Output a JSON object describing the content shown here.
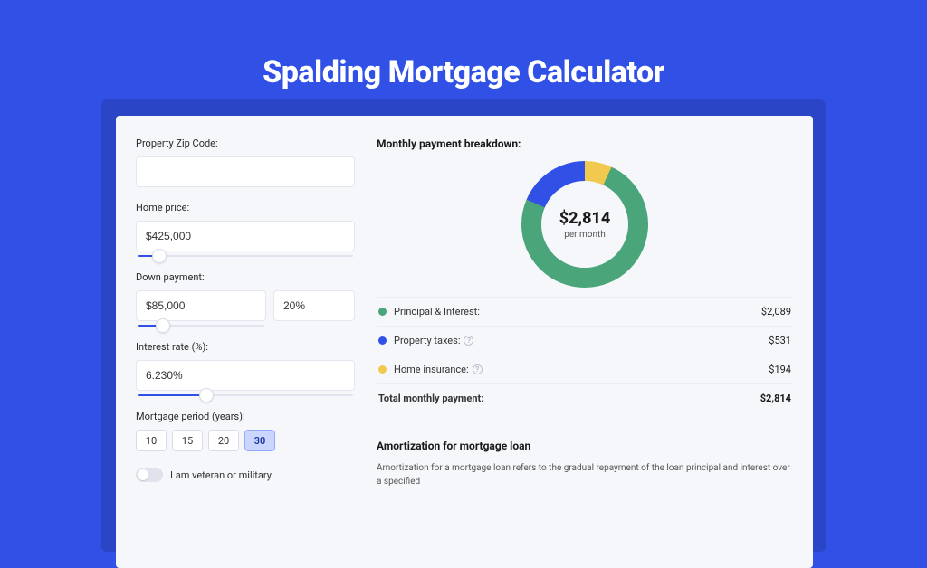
{
  "page": {
    "title": "Spalding Mortgage Calculator"
  },
  "form": {
    "zip": {
      "label": "Property Zip Code:",
      "value": ""
    },
    "home_price": {
      "label": "Home price:",
      "value": "$425,000",
      "slider_pct": 10
    },
    "down_payment": {
      "label": "Down payment:",
      "amount": "$85,000",
      "pct": "20%",
      "slider_pct": 20
    },
    "interest_rate": {
      "label": "Interest rate (%):",
      "value": "6.230%",
      "slider_pct": 32
    },
    "period": {
      "label": "Mortgage period (years):",
      "options": [
        "10",
        "15",
        "20",
        "30"
      ],
      "selected": "30"
    },
    "veteran": {
      "label": "I am veteran or military",
      "value": false
    }
  },
  "breakdown": {
    "title": "Monthly payment breakdown:",
    "amount": "$2,814",
    "sub": "per month",
    "items": [
      {
        "label": "Principal & Interest:",
        "value": "$2,089",
        "color": "#4aa57a",
        "help": false
      },
      {
        "label": "Property taxes:",
        "value": "$531",
        "color": "#3151e6",
        "help": true
      },
      {
        "label": "Home insurance:",
        "value": "$194",
        "color": "#f1c94f",
        "help": true
      }
    ],
    "total_label": "Total monthly payment:",
    "total_value": "$2,814"
  },
  "amortization": {
    "title": "Amortization for mortgage loan",
    "body": "Amortization for a mortgage loan refers to the gradual repayment of the loan principal and interest over a specified"
  },
  "chart_data": {
    "type": "pie",
    "title": "Monthly payment breakdown",
    "series": [
      {
        "name": "Principal & Interest",
        "value": 2089,
        "color": "#4aa57a"
      },
      {
        "name": "Property taxes",
        "value": 531,
        "color": "#3151e6"
      },
      {
        "name": "Home insurance",
        "value": 194,
        "color": "#f1c94f"
      }
    ],
    "total": 2814,
    "unit": "USD per month"
  }
}
